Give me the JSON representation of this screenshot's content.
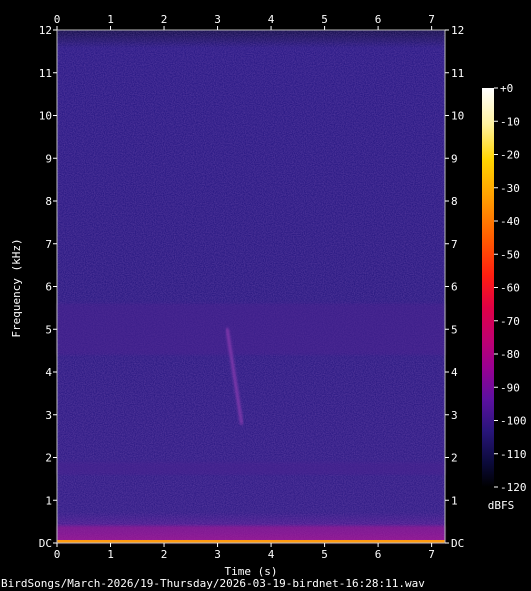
{
  "chart_data": {
    "type": "heatmap",
    "xlabel": "Time (s)",
    "ylabel": "Frequency (kHz)",
    "x_ticks": [
      "0",
      "1",
      "2",
      "3",
      "4",
      "5",
      "6",
      "7"
    ],
    "y_ticks": [
      "DC",
      "1",
      "2",
      "3",
      "4",
      "5",
      "6",
      "7",
      "8",
      "9",
      "10",
      "11",
      "12"
    ],
    "xlim": [
      0,
      7.25
    ],
    "ylim": [
      0,
      12
    ],
    "colorbar": {
      "label": "dBFS",
      "range": [
        -120,
        0
      ],
      "ticks": [
        "+0",
        "-10",
        "-20",
        "-30",
        "-40",
        "-50",
        "-60",
        "-70",
        "-80",
        "-90",
        "-100",
        "-110",
        "-120"
      ],
      "colors": [
        "#ffffff",
        "#fff2a0",
        "#ffd400",
        "#ff9a00",
        "#ff5a00",
        "#ff1e10",
        "#e00045",
        "#c00070",
        "#9a0092",
        "#5c10a0",
        "#28157a",
        "#0b0a3a",
        "#000000"
      ]
    },
    "background_level_dbfs": -103,
    "features": [
      {
        "kind": "noise-band",
        "t_start": 0,
        "t_end": 7.25,
        "f_low": 4.4,
        "f_high": 5.6,
        "level_dbfs": -92
      },
      {
        "kind": "chirp",
        "t_start": 3.18,
        "t_end": 3.45,
        "f_start": 5.0,
        "f_end": 2.8,
        "level_dbfs": -85
      },
      {
        "kind": "low-band",
        "t_start": 0,
        "t_end": 7.25,
        "f_low": 1.6,
        "f_high": 1.9,
        "level_dbfs": -95
      },
      {
        "kind": "low-energy",
        "t_start": 0,
        "t_end": 7.25,
        "f_low": 0,
        "f_high": 0.4,
        "level_dbfs": -80
      }
    ]
  },
  "footer": {
    "filename": "BirdSongs/March-2026/19-Thursday/2026-03-19-birdnet-16:28:11.wav"
  }
}
